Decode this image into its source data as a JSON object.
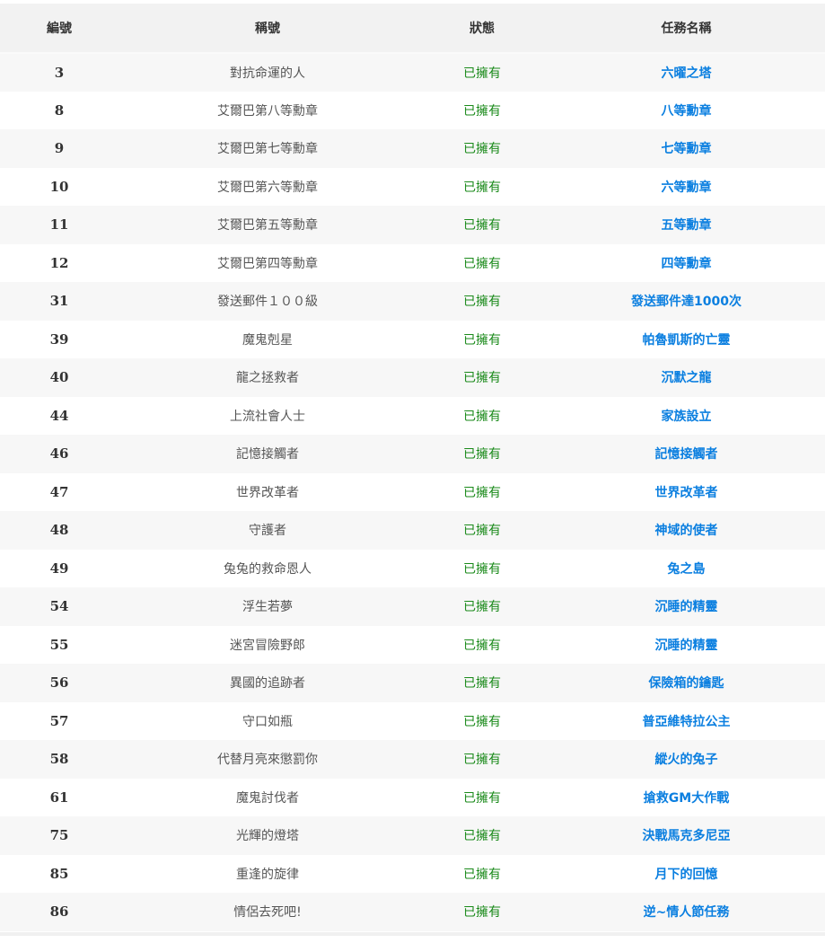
{
  "headers": {
    "id": "編號",
    "title": "稱號",
    "status": "狀態",
    "mission": "任務名稱"
  },
  "rows": [
    {
      "id": "3",
      "title": "對抗命運的人",
      "status": "已擁有",
      "mission": "六曜之塔"
    },
    {
      "id": "8",
      "title": "艾爾巴第八等勳章",
      "status": "已擁有",
      "mission": "八等勳章"
    },
    {
      "id": "9",
      "title": "艾爾巴第七等勳章",
      "status": "已擁有",
      "mission": "七等勳章"
    },
    {
      "id": "10",
      "title": "艾爾巴第六等勳章",
      "status": "已擁有",
      "mission": "六等勳章"
    },
    {
      "id": "11",
      "title": "艾爾巴第五等勳章",
      "status": "已擁有",
      "mission": "五等勳章"
    },
    {
      "id": "12",
      "title": "艾爾巴第四等勳章",
      "status": "已擁有",
      "mission": "四等勳章"
    },
    {
      "id": "31",
      "title": "發送郵件１００級",
      "status": "已擁有",
      "mission": "發送郵件達1000次"
    },
    {
      "id": "39",
      "title": "魔鬼剋星",
      "status": "已擁有",
      "mission": "帕魯凱斯的亡靈"
    },
    {
      "id": "40",
      "title": "龍之拯救者",
      "status": "已擁有",
      "mission": "沉默之龍"
    },
    {
      "id": "44",
      "title": "上流社會人士",
      "status": "已擁有",
      "mission": "家族設立"
    },
    {
      "id": "46",
      "title": "記憶接觸者",
      "status": "已擁有",
      "mission": "記憶接觸者"
    },
    {
      "id": "47",
      "title": "世界改革者",
      "status": "已擁有",
      "mission": "世界改革者"
    },
    {
      "id": "48",
      "title": "守護者",
      "status": "已擁有",
      "mission": "神域的使者"
    },
    {
      "id": "49",
      "title": "兔兔的救命恩人",
      "status": "已擁有",
      "mission": "兔之島"
    },
    {
      "id": "54",
      "title": "浮生若夢",
      "status": "已擁有",
      "mission": "沉睡的精靈"
    },
    {
      "id": "55",
      "title": "迷宮冒險野郎",
      "status": "已擁有",
      "mission": "沉睡的精靈"
    },
    {
      "id": "56",
      "title": "異國的追跡者",
      "status": "已擁有",
      "mission": "保險箱的鑰匙"
    },
    {
      "id": "57",
      "title": "守口如瓶",
      "status": "已擁有",
      "mission": "普亞維特拉公主"
    },
    {
      "id": "58",
      "title": "代替月亮來懲罰你",
      "status": "已擁有",
      "mission": "縱火的兔子"
    },
    {
      "id": "61",
      "title": "魔鬼討伐者",
      "status": "已擁有",
      "mission": "搶救GM大作戰"
    },
    {
      "id": "75",
      "title": "光輝的燈塔",
      "status": "已擁有",
      "mission": "決戰馬克多尼亞"
    },
    {
      "id": "85",
      "title": "重逢的旋律",
      "status": "已擁有",
      "mission": "月下的回憶"
    },
    {
      "id": "86",
      "title": "情侶去死吧!",
      "status": "已擁有",
      "mission": "逆~情人節任務"
    }
  ],
  "colors": {
    "status_green": "#1a8a1a",
    "mission_link_blue": "#0b7fe0",
    "header_bg": "#f2f2f2",
    "stripe_bg": "#f7f7f7"
  }
}
